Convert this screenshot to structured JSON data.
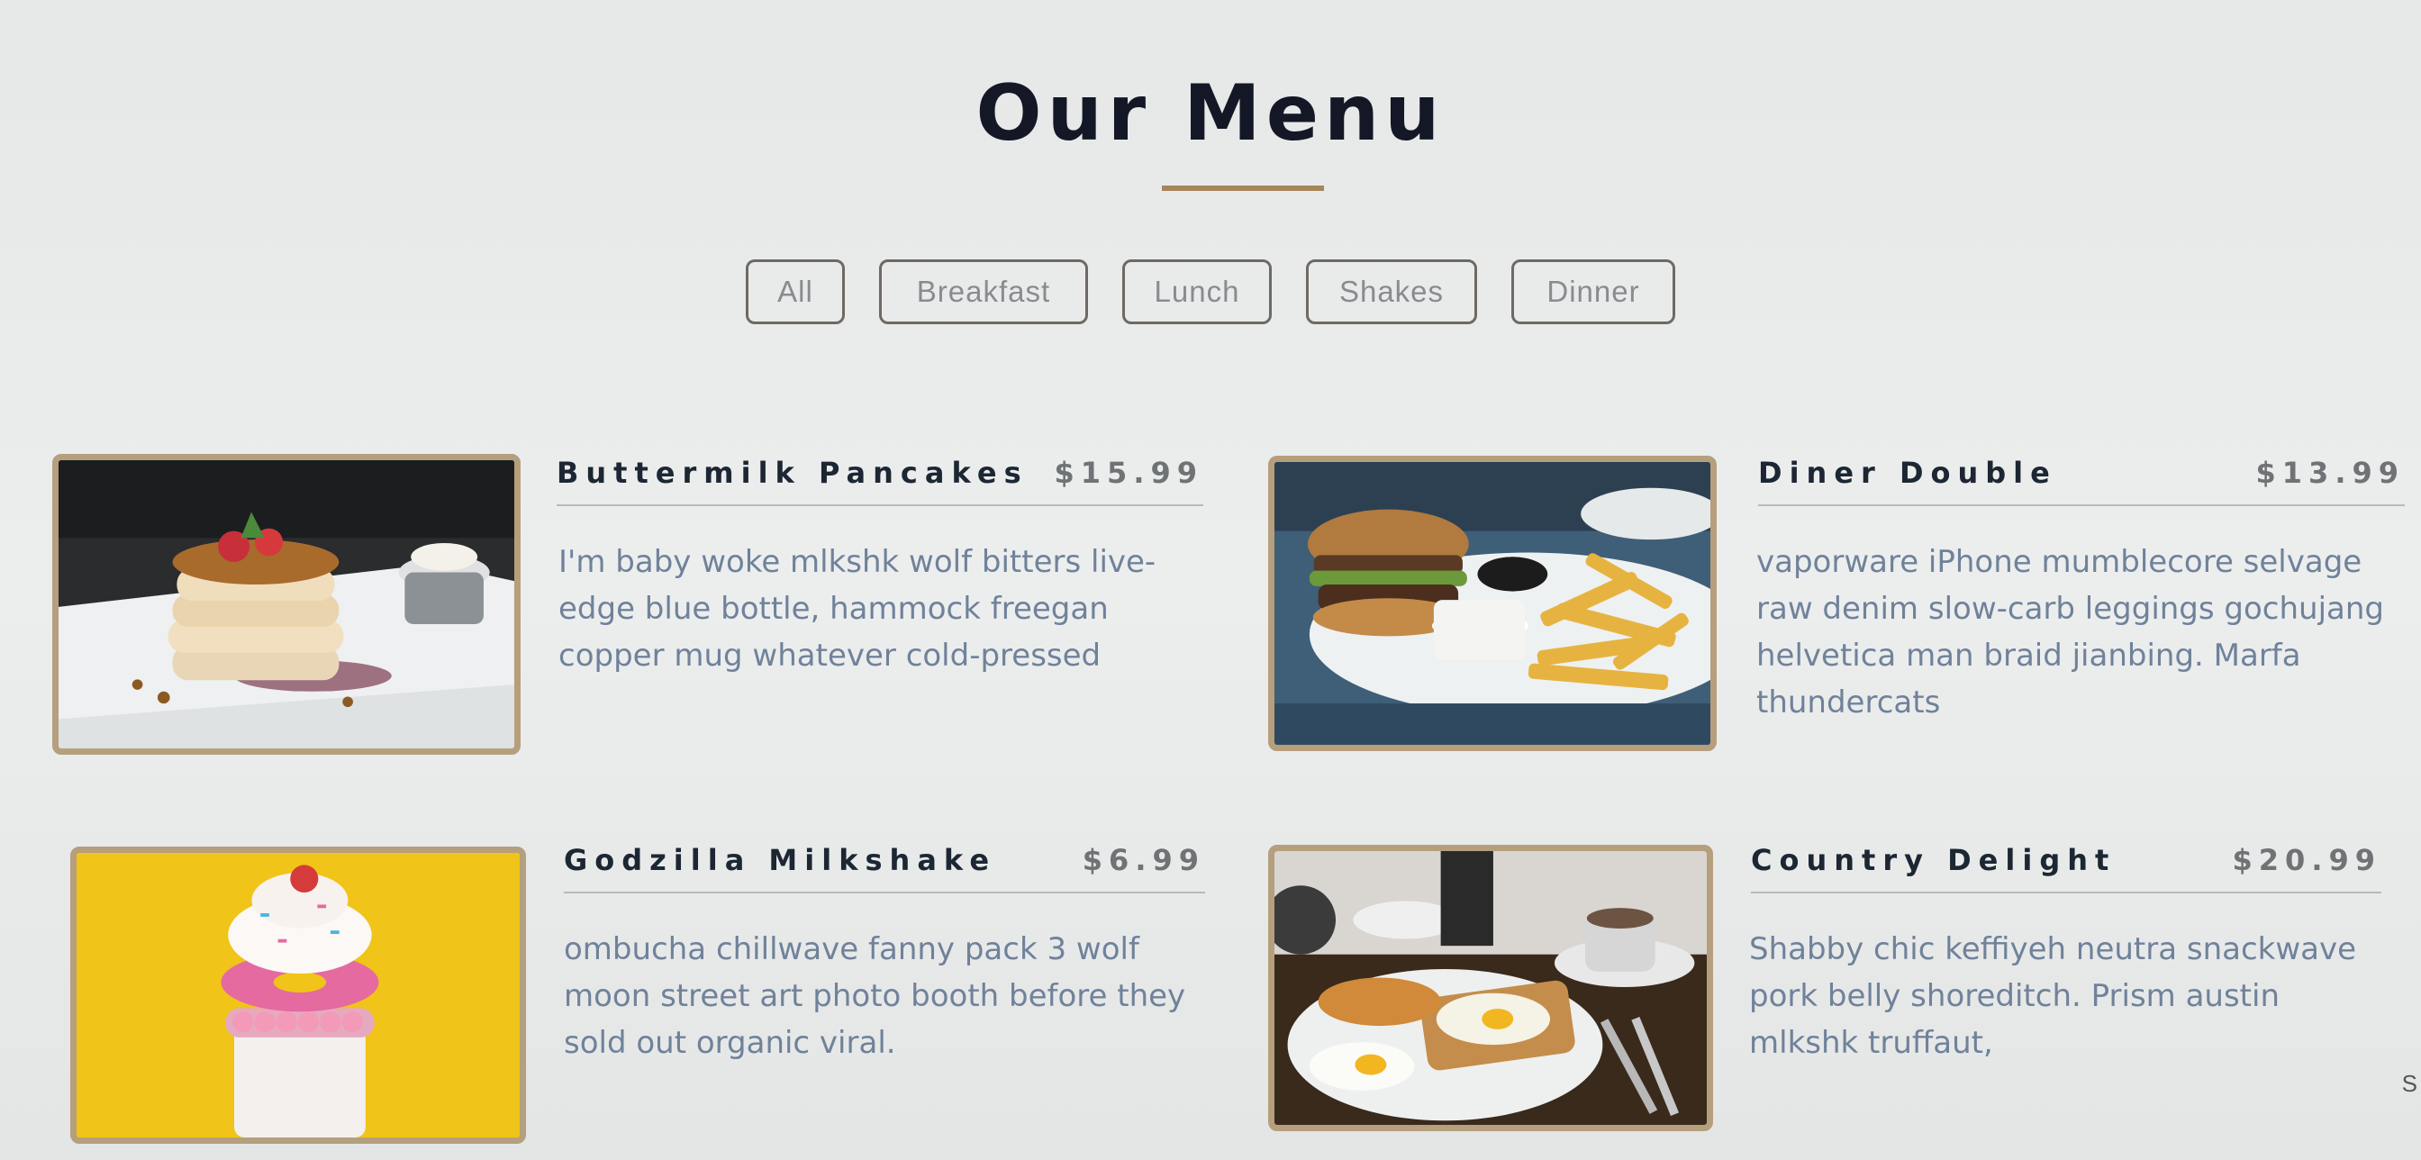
{
  "page": {
    "title": "Our Menu",
    "accent_color": "#a5865b"
  },
  "filters": [
    {
      "label": "All"
    },
    {
      "label": "Breakfast"
    },
    {
      "label": "Lunch"
    },
    {
      "label": "Shakes"
    },
    {
      "label": "Dinner"
    }
  ],
  "items": [
    {
      "name": "Buttermilk Pancakes",
      "price": "$15.99",
      "description": "I'm baby woke mlkshk wolf bitters live-edge blue bottle, hammock freegan copper mug whatever cold-pressed",
      "image": "pancakes-photo"
    },
    {
      "name": "Diner Double",
      "price": "$13.99",
      "description": "vaporware iPhone mumblecore selvage raw denim slow-carb leggings gochujang helvetica man braid jianbing. Marfa thundercats",
      "image": "burger-fries-photo"
    },
    {
      "name": "Godzilla Milkshake",
      "price": "$6.99",
      "description": "ombucha chillwave fanny pack 3 wolf moon street art photo booth before they sold out organic viral.",
      "image": "milkshake-photo"
    },
    {
      "name": "Country Delight",
      "price": "$20.99",
      "description": "Shabby chic keffiyeh neutra snackwave pork belly shoreditch. Prism austin mlkshk truffaut,",
      "image": "breakfast-plate-photo"
    }
  ],
  "edge_text": "S"
}
